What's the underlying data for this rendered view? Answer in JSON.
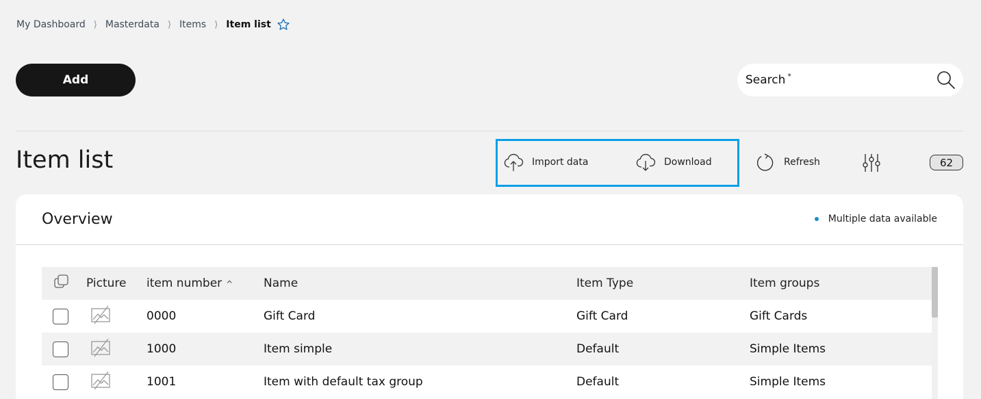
{
  "breadcrumb": {
    "items": [
      "My Dashboard",
      "Masterdata",
      "Items"
    ],
    "current": "Item list",
    "separator": "⟩"
  },
  "toolbar": {
    "add_label": "Add",
    "search_label": "Search",
    "search_required": "*"
  },
  "page": {
    "title": "Item list"
  },
  "actions": {
    "import_label": "Import data",
    "download_label": "Download",
    "refresh_label": "Refresh",
    "count": "62"
  },
  "overview": {
    "title": "Overview",
    "status": "Multiple data available"
  },
  "table": {
    "columns": {
      "picture": "Picture",
      "item_number": "item number",
      "sort_indicator": "^",
      "name": "Name",
      "item_type": "Item Type",
      "item_groups": "Item groups"
    },
    "rows": [
      {
        "number": "0000",
        "name": "Gift Card",
        "type": "Gift Card",
        "groups": "Gift Cards"
      },
      {
        "number": "1000",
        "name": "Item simple",
        "type": "Default",
        "groups": "Simple Items"
      },
      {
        "number": "1001",
        "name": "Item with default tax group",
        "type": "Default",
        "groups": "Simple Items"
      }
    ]
  },
  "colors": {
    "highlight": "#0a9ee6",
    "status_dot": "#1a8fc4",
    "add_button": "#161616"
  },
  "icons": {
    "star": "star-icon",
    "search": "search-icon",
    "import": "cloud-upload-icon",
    "download": "cloud-download-icon",
    "refresh": "refresh-icon",
    "filter": "sliders-icon",
    "picture": "image-placeholder-icon",
    "select_all": "copy-icon"
  }
}
